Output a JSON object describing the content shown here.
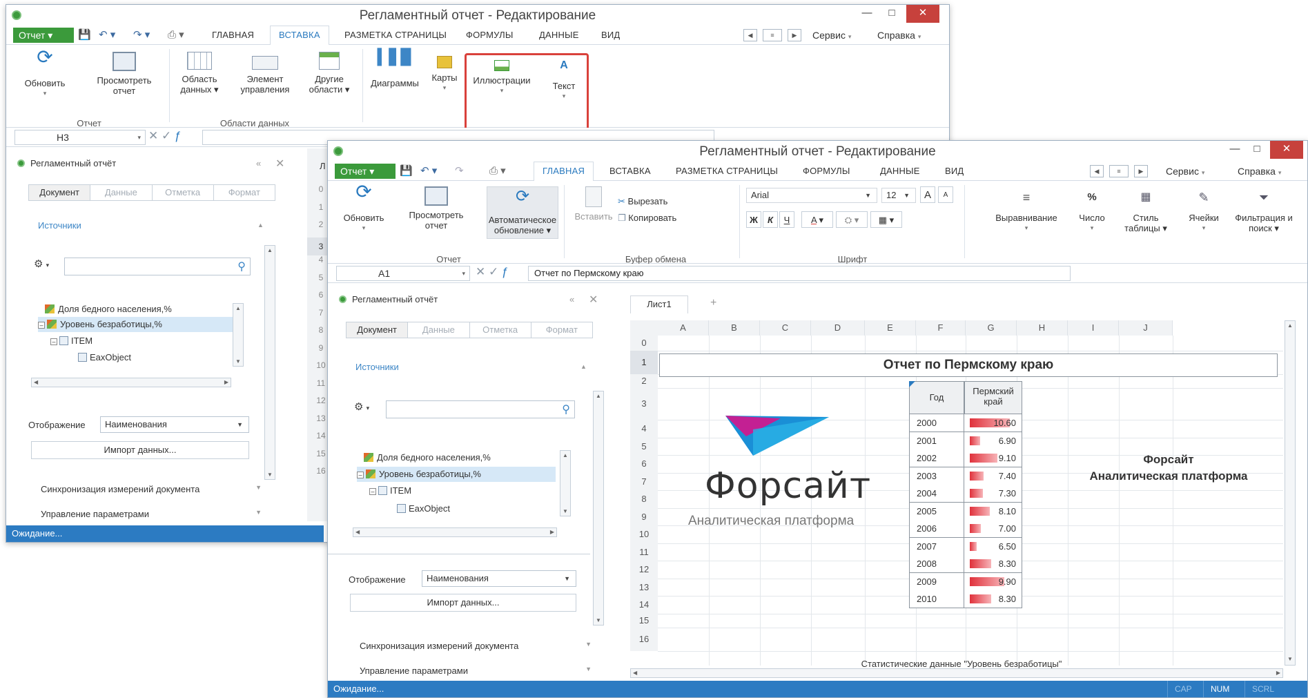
{
  "back_window": {
    "title": "Регламентный отчет - Редактирование",
    "menu": {
      "report_label": "Отчет",
      "tabs": [
        "ГЛАВНАЯ",
        "ВСТАВКА",
        "РАЗМЕТКА СТРАНИЦЫ",
        "ФОРМУЛЫ",
        "ДАННЫЕ",
        "ВИД"
      ],
      "active_tab": "ВСТАВКА",
      "service": "Сервис",
      "help": "Справка"
    },
    "ribbon": {
      "buttons": [
        {
          "label": "Обновить"
        },
        {
          "label": "Просмотреть отчет"
        },
        {
          "label": "Область данных"
        },
        {
          "label": "Элемент управления"
        },
        {
          "label": "Другие области"
        },
        {
          "label": "Диаграммы"
        },
        {
          "label": "Карты"
        },
        {
          "label": "Иллюстрации"
        },
        {
          "label": "Текст"
        }
      ],
      "groups": [
        "Отчет",
        "Области данных"
      ]
    },
    "cell_ref": "H3",
    "panel": {
      "title": "Регламентный отчёт",
      "tabs": [
        "Документ",
        "Данные",
        "Отметка",
        "Формат"
      ],
      "sources_label": "Источники",
      "tree": [
        "Доля бедного населения,%",
        "Уровень безработицы,%",
        "ITEM",
        "EaxObject"
      ],
      "display_label": "Отображение",
      "display_value": "Наименования",
      "import_button": "Импорт данных...",
      "sync_section": "Синхронизация измерений документа",
      "params_section": "Управление параметрами"
    },
    "sheet_tab_partial": "Л",
    "row_numbers": [
      "0",
      "1",
      "2",
      "3",
      "4",
      "5",
      "6",
      "7",
      "8",
      "9",
      "10",
      "11",
      "12",
      "13",
      "14",
      "15",
      "16"
    ],
    "status": "Ожидание..."
  },
  "front_window": {
    "title": "Регламентный отчет - Редактирование",
    "menu": {
      "report_label": "Отчет",
      "tabs": [
        "ГЛАВНАЯ",
        "ВСТАВКА",
        "РАЗМЕТКА СТРАНИЦЫ",
        "ФОРМУЛЫ",
        "ДАННЫЕ",
        "ВИД"
      ],
      "active_tab": "ГЛАВНАЯ",
      "service": "Сервис",
      "help": "Справка"
    },
    "ribbon": {
      "refresh": "Обновить",
      "view_report": "Просмотреть отчет",
      "auto_update": "Автоматическое обновление",
      "paste": "Вставить",
      "cut": "Вырезать",
      "copy": "Копировать",
      "font_name": "Arial",
      "font_size": "12",
      "bold": "Ж",
      "italic": "К",
      "underline": "Ч",
      "font_grow": "A",
      "font_shrink": "A",
      "font_color": "A",
      "align": "Выравнивание",
      "number": "Число",
      "table_style": "Стиль таблицы",
      "cells": "Ячейки",
      "filter_search": "Фильтрация и поиск",
      "groups": {
        "report": "Отчет",
        "clipboard": "Буфер обмена",
        "font": "Шрифт"
      }
    },
    "cell_ref": "A1",
    "formula": "Отчет по Пермскому краю",
    "panel": {
      "title": "Регламентный отчёт",
      "tabs": [
        "Документ",
        "Данные",
        "Отметка",
        "Формат"
      ],
      "sources_label": "Источники",
      "tree": [
        "Доля бедного населения,%",
        "Уровень безработицы,%",
        "ITEM",
        "EaxObject"
      ],
      "display_label": "Отображение",
      "display_value": "Наименования",
      "import_button": "Импорт данных...",
      "sync_section": "Синхронизация измерений документа",
      "params_section": "Управление параметрами"
    },
    "sheet": {
      "tab": "Лист1",
      "add_tab": "+",
      "columns": [
        "A",
        "B",
        "C",
        "D",
        "E",
        "F",
        "G",
        "H",
        "I",
        "J"
      ],
      "rows": [
        "0",
        "1",
        "2",
        "3",
        "4",
        "5",
        "6",
        "7",
        "8",
        "9",
        "10",
        "11",
        "12",
        "13",
        "14",
        "15",
        "16"
      ],
      "report_title": "Отчет по Пермскому краю",
      "table_header": {
        "year": "Год",
        "region": "Пермский край"
      },
      "table_rows": [
        {
          "year": "2000",
          "value": "10.60",
          "num": 10.6
        },
        {
          "year": "2001",
          "value": "6.90",
          "num": 6.9
        },
        {
          "year": "2002",
          "value": "9.10",
          "num": 9.1
        },
        {
          "year": "2003",
          "value": "7.40",
          "num": 7.4
        },
        {
          "year": "2004",
          "value": "7.30",
          "num": 7.3
        },
        {
          "year": "2005",
          "value": "8.10",
          "num": 8.1
        },
        {
          "year": "2006",
          "value": "7.00",
          "num": 7.0
        },
        {
          "year": "2007",
          "value": "6.50",
          "num": 6.5
        },
        {
          "year": "2008",
          "value": "8.30",
          "num": 8.3
        },
        {
          "year": "2009",
          "value": "9.90",
          "num": 9.9
        },
        {
          "year": "2010",
          "value": "8.30",
          "num": 8.3
        }
      ],
      "logo_name": "Форсайт",
      "logo_sub": "Аналитическая платформа",
      "side_title_1": "Форсайт",
      "side_title_2": "Аналитическая платформа",
      "footer": "Статистические данные \"Уровень безработицы\""
    },
    "status": "Ожидание...",
    "indicators": [
      "CAP",
      "NUM",
      "SCRL"
    ]
  },
  "colors": {
    "accent_green": "#3b9a3b",
    "status_blue": "#2c7bc2",
    "bar_red": "#e0313b",
    "highlight_red": "#d9413b"
  }
}
